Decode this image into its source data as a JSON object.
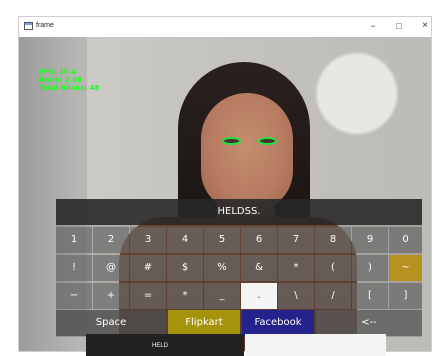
{
  "window": {
    "title": "frame",
    "controls": {
      "minimize": "−",
      "maximize": "□",
      "close": "×"
    }
  },
  "stats": {
    "fps": "FPS: 15.4",
    "ratio": "Ratio: 2.08",
    "total_blinks": "Total Blinks: 48"
  },
  "keyboard": {
    "typed_text": "HELDSS.",
    "rows": [
      [
        "1",
        "2",
        "3",
        "4",
        "5",
        "6",
        "7",
        "8",
        "9",
        "0"
      ],
      [
        "!",
        "@",
        "#",
        "$",
        "%",
        "&",
        "*",
        "(",
        ")",
        "~"
      ],
      [
        "−",
        "+",
        "=",
        "*",
        "_",
        ".",
        "\\",
        "/",
        "[",
        "]"
      ]
    ],
    "bottom_row": {
      "space": "Space",
      "flipkart": "Flipkart",
      "facebook": "Facebook",
      "backspace": "<--"
    }
  },
  "taskbar": {
    "label": "HELD"
  },
  "colors": {
    "eye_outline": "#1ee43c",
    "stats_text": "#18ff18",
    "flipkart": "#a5930c",
    "facebook": "#24228b",
    "highlight_gold": "#b89220"
  },
  "icons": {
    "app": "window-app-icon",
    "minimize": "minimize-icon",
    "maximize": "maximize-icon",
    "close": "close-icon"
  }
}
